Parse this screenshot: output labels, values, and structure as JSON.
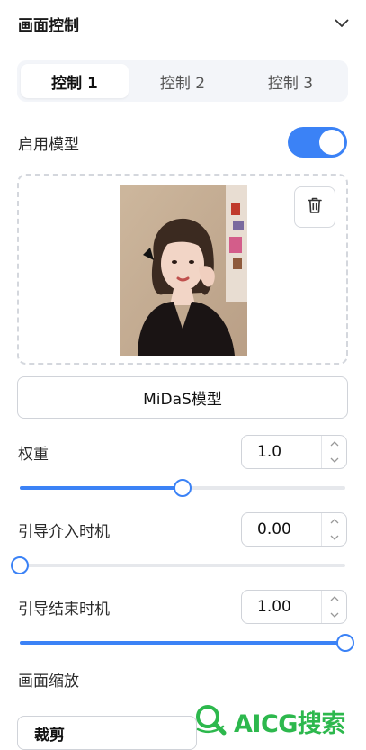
{
  "header": {
    "title": "画面控制",
    "collapse_icon": "chevron-down-icon"
  },
  "tabs": [
    {
      "label": "控制 1",
      "active": true
    },
    {
      "label": "控制 2",
      "active": false
    },
    {
      "label": "控制 3",
      "active": false
    }
  ],
  "enable_model": {
    "label": "启用模型",
    "on": true
  },
  "upload": {
    "delete_icon": "trash-icon"
  },
  "model_button": {
    "label": "MiDaS模型"
  },
  "params": [
    {
      "label": "权重",
      "value": "1.0",
      "slider_fraction": 0.5
    },
    {
      "label": "引导介入时机",
      "value": "0.00",
      "slider_fraction": 0.0
    },
    {
      "label": "引导结束时机",
      "value": "1.00",
      "slider_fraction": 1.0
    }
  ],
  "scale": {
    "label": "画面缩放",
    "selected": "裁剪"
  },
  "watermark": {
    "text": "AICG搜索"
  },
  "colors": {
    "accent": "#3b82f6",
    "watermark": "#2db84d"
  }
}
